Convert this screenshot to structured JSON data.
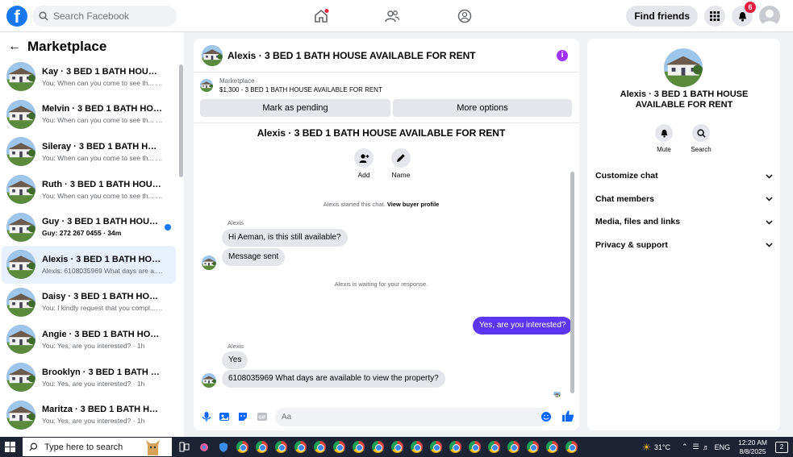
{
  "topbar": {
    "search_placeholder": "Search Facebook",
    "find_friends": "Find friends",
    "notif_count": "6"
  },
  "sidebar": {
    "title": "Marketplace",
    "conversations": [
      {
        "name": "Kay · 3 BED 1 BATH HOUSE AVAI...",
        "preview": "You: When can you come to see th... · 1m",
        "unread": false
      },
      {
        "name": "Melvin · 3 BED 1 BATH HOUSE A...",
        "preview": "You: When can you come to see th... · 1m",
        "unread": false
      },
      {
        "name": "Sileray · 3 BED 1 BATH HOUSE A...",
        "preview": "You: When can you come to see th... · 2m",
        "unread": false
      },
      {
        "name": "Ruth · 3 BED 1 BATH HOUSE AVA...",
        "preview": "You: When can you come to see th... · 3m",
        "unread": false
      },
      {
        "name": "Guy · 3 BED 1 BATH HOUSE AV...",
        "preview": "Guy: 272 267 0455 · 34m",
        "unread": true
      },
      {
        "name": "Alexis · 3 BED 1 BATH HOUSE AV...",
        "preview": "Alexis: 6108035969 What days are a... · 1h",
        "unread": false,
        "active": true
      },
      {
        "name": "Daisy · 3 BED 1 BATH HOUSE AV...",
        "preview": "You: I kindly request that you compl... · 1h",
        "unread": false
      },
      {
        "name": "Angie · 3 BED 1 BATH HOUSE AV...",
        "preview": "You: Yes, are you interested? · 1h",
        "unread": false
      },
      {
        "name": "Brooklyn · 3 BED 1 BATH HOUSE ...",
        "preview": "You: Yes, are you interested? · 1h",
        "unread": false
      },
      {
        "name": "Maritza · 3 BED 1 BATH HOUSE A...",
        "preview": "You: Yes, are you interested? · 1h",
        "unread": false
      }
    ]
  },
  "chat": {
    "title": "Alexis · 3 BED 1 BATH HOUSE AVAILABLE FOR RENT",
    "listing_source": "Marketplace",
    "listing_price_title": "$1,300 - 3 BED 1 BATH HOUSE AVAILABLE FOR RENT",
    "mark_pending": "Mark as pending",
    "more_options": "More options",
    "conversation_header": "Alexis · 3 BED 1 BATH HOUSE AVAILABLE FOR RENT",
    "add_label": "Add",
    "name_label": "Name",
    "started_text": "Alexis started this chat.",
    "view_buyer_profile": "View buyer profile",
    "sender_1": "Alexis",
    "msg_1": "Hi Aeman, is this still available?",
    "msg_2": "Message sent",
    "waiting_text": "Alexis is waiting for your response.",
    "msg_out": "Yes, are you interested?",
    "sender_2": "Alexis",
    "msg_3": "Yes",
    "msg_4": "6108035969 What days are available to view the property?",
    "composer_placeholder": "Aa"
  },
  "panel": {
    "title": "Alexis · 3 BED 1 BATH HOUSE AVAILABLE FOR RENT",
    "mute_label": "Mute",
    "search_label": "Search",
    "rows": [
      "Customize chat",
      "Chat members",
      "Media, files and links",
      "Privacy & support"
    ]
  },
  "taskbar": {
    "search_text": "Type here to search",
    "temperature": "31°C",
    "lang": "ENG",
    "time": "12:20 AM",
    "date": "8/8/2025",
    "notif": "2"
  },
  "colors": {
    "accent": "#1877f2",
    "outgoing_bubble": "#5b36f5",
    "info": "#a033ff"
  }
}
